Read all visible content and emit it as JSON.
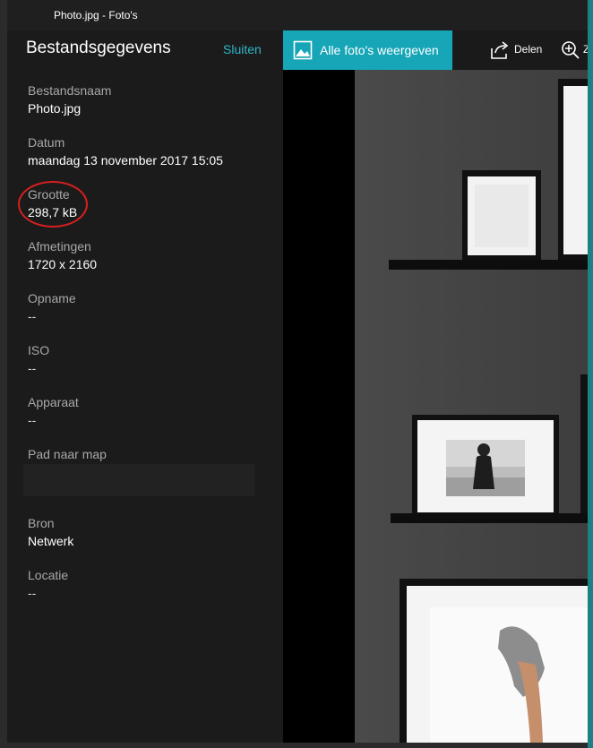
{
  "window": {
    "title": "Photo.jpg - Foto's"
  },
  "panel": {
    "title": "Bestandsgegevens",
    "close_label": "Sluiten",
    "fields": [
      {
        "label": "Bestandsnaam",
        "value": "Photo.jpg"
      },
      {
        "label": "Datum",
        "value": "maandag 13 november 2017 15:05"
      },
      {
        "label": "Grootte",
        "value": "298,7 kB"
      },
      {
        "label": "Afmetingen",
        "value": "1720 x 2160"
      },
      {
        "label": "Opname",
        "value": "--"
      },
      {
        "label": "ISO",
        "value": "--"
      },
      {
        "label": "Apparaat",
        "value": "--"
      },
      {
        "label": "Pad naar map",
        "value": ""
      },
      {
        "label": "Bron",
        "value": "Netwerk"
      },
      {
        "label": "Locatie",
        "value": "--"
      }
    ]
  },
  "toolbar": {
    "all_photos_label": "Alle foto's weergeven",
    "share_label": "Delen",
    "zoom_label": "Z"
  },
  "colors": {
    "accent": "#16a6b7",
    "link": "#2fb6c7",
    "annotation": "#d61f1f"
  },
  "icons": {
    "all_photos": "image-icon",
    "share": "share-icon",
    "zoom": "zoom-in-icon"
  }
}
